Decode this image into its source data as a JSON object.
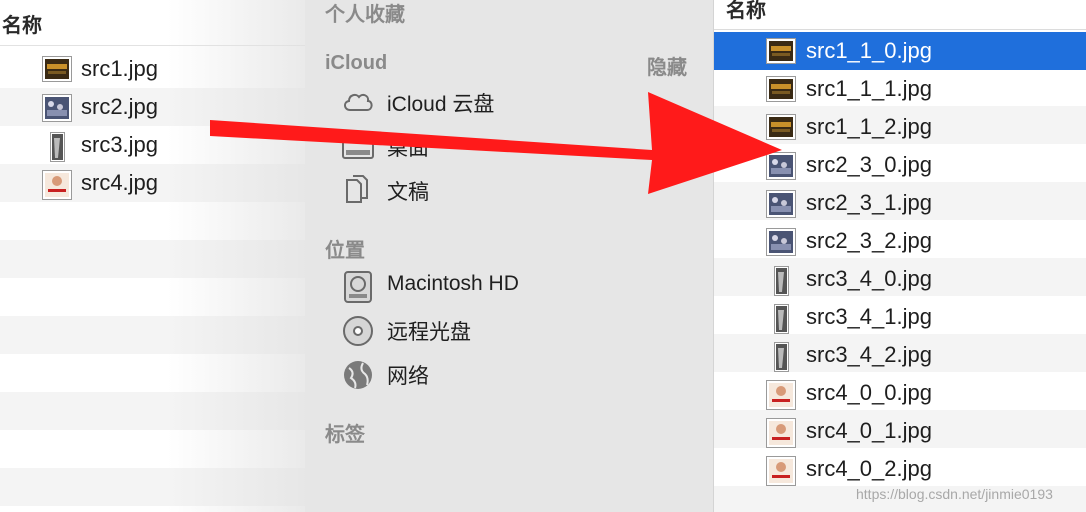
{
  "left_pane": {
    "column_header": "名称",
    "files": [
      {
        "name": "src1.jpg",
        "thumb": "concert"
      },
      {
        "name": "src2.jpg",
        "thumb": "crowd"
      },
      {
        "name": "src3.jpg",
        "thumb": "portrait"
      },
      {
        "name": "src4.jpg",
        "thumb": "poster"
      }
    ]
  },
  "sidebar": {
    "favorites_header": "个人收藏",
    "icloud_header": "iCloud",
    "hide_label": "隐藏",
    "icloud_items": [
      {
        "label": "iCloud 云盘",
        "icon": "cloud-icon"
      },
      {
        "label": "桌面",
        "icon": "desktop-icon"
      },
      {
        "label": "文稿",
        "icon": "document-icon"
      }
    ],
    "locations_header": "位置",
    "location_items": [
      {
        "label": "Macintosh HD",
        "icon": "hard-drive-icon"
      },
      {
        "label": "远程光盘",
        "icon": "disc-icon"
      },
      {
        "label": "网络",
        "icon": "network-globe-icon"
      }
    ],
    "tags_header": "标签"
  },
  "right_pane": {
    "column_header": "名称",
    "files": [
      {
        "name": "src1_1_0.jpg",
        "thumb": "concert",
        "selected": true
      },
      {
        "name": "src1_1_1.jpg",
        "thumb": "concert"
      },
      {
        "name": "src1_1_2.jpg",
        "thumb": "concert"
      },
      {
        "name": "src2_3_0.jpg",
        "thumb": "crowd"
      },
      {
        "name": "src2_3_1.jpg",
        "thumb": "crowd"
      },
      {
        "name": "src2_3_2.jpg",
        "thumb": "crowd"
      },
      {
        "name": "src3_4_0.jpg",
        "thumb": "portrait"
      },
      {
        "name": "src3_4_1.jpg",
        "thumb": "portrait"
      },
      {
        "name": "src3_4_2.jpg",
        "thumb": "portrait"
      },
      {
        "name": "src4_0_0.jpg",
        "thumb": "poster"
      },
      {
        "name": "src4_0_1.jpg",
        "thumb": "poster"
      },
      {
        "name": "src4_0_2.jpg",
        "thumb": "poster"
      }
    ]
  },
  "watermark": "https://blog.csdn.net/jinmie0193",
  "colors": {
    "selection": "#1f6fdc",
    "arrow": "#ff1a1a",
    "sidebar_bg": "#e6e6e6"
  }
}
